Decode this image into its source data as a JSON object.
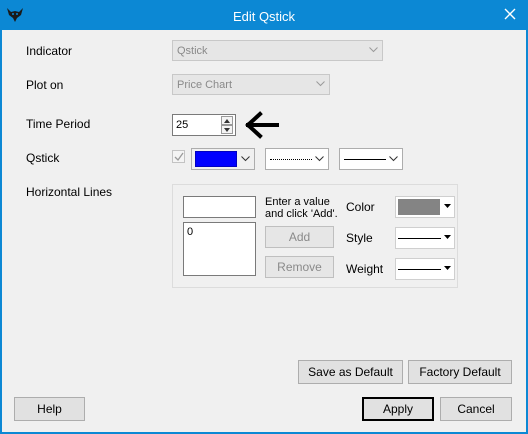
{
  "window": {
    "title": "Edit Qstick"
  },
  "labels": {
    "indicator": "Indicator",
    "plot_on": "Plot on",
    "time_period": "Time Period",
    "qstick": "Qstick",
    "horizontal_lines": "Horizontal Lines"
  },
  "fields": {
    "indicator_value": "Qstick",
    "plot_on_value": "Price Chart",
    "time_period_value": "25",
    "qstick_checked": true,
    "qstick_color": "#0000ff"
  },
  "hlines": {
    "input_value": "",
    "hint_line1": "Enter a value",
    "hint_line2": "and click 'Add'.",
    "list_items": [
      "0"
    ],
    "add_label": "Add",
    "remove_label": "Remove",
    "color_label": "Color",
    "style_label": "Style",
    "weight_label": "Weight",
    "color_value": "#848484"
  },
  "buttons": {
    "save_default": "Save as Default",
    "factory_default": "Factory Default",
    "help": "Help",
    "apply": "Apply",
    "cancel": "Cancel"
  },
  "colors": {
    "titlebar": "#0c88d4",
    "dialog_bg": "#f0f0f0"
  }
}
